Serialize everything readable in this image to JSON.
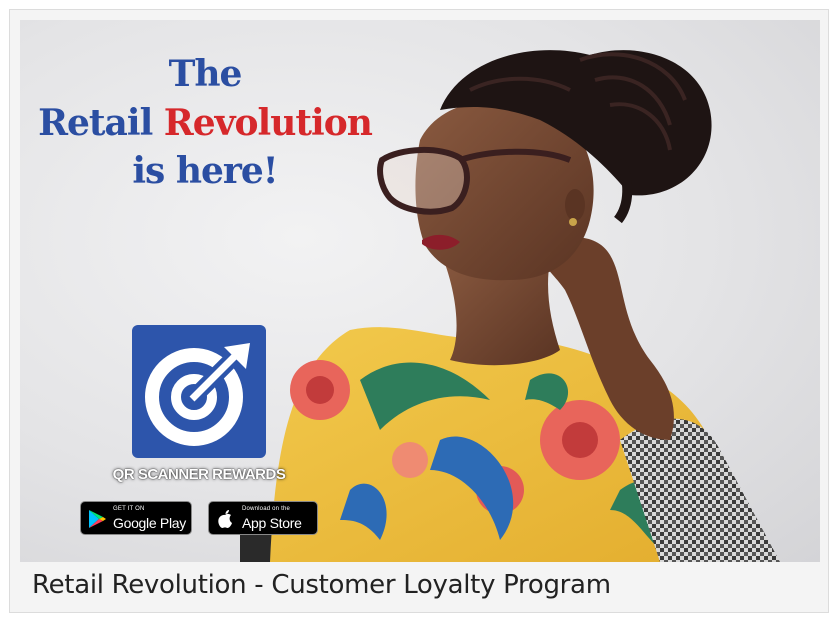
{
  "headline": {
    "line1": "The",
    "line2_part1": "Retail",
    "line2_part2": "Revolution",
    "line3": "is here!"
  },
  "app": {
    "name": "QR SCANNER REWARDS",
    "icon": "target-arrow-icon",
    "brand_color": "#2d55ab"
  },
  "stores": {
    "google_play": {
      "small": "GET IT ON",
      "big": "Google Play",
      "icon": "google-play-icon"
    },
    "app_store": {
      "small": "Download on the",
      "big": "App Store",
      "icon": "apple-icon"
    }
  },
  "caption": "Retail Revolution - Customer Loyalty Program",
  "colors": {
    "headline_blue": "#2b4ea2",
    "headline_red": "#d6282b"
  }
}
